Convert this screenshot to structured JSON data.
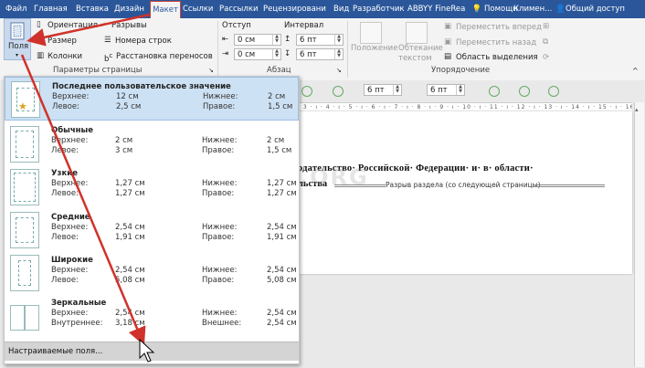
{
  "tabs": [
    "Файл",
    "Главная",
    "Вставка",
    "Дизайн",
    "Макет",
    "Ссылки",
    "Рассылки",
    "Рецензировани",
    "Вид",
    "Разработчик",
    "ABBYY FineRea"
  ],
  "active_tab": "Макет",
  "help": "Помощн",
  "user": "Климен...",
  "share": "Общий доступ",
  "ribbon": {
    "fields": "Поля",
    "orientation": "Ориентация",
    "size": "Размер",
    "columns": "Колонки",
    "breaks": "Разрывы",
    "line_numbers": "Номера строк",
    "hyphenation": "Расстановка переносов",
    "page_setup_group": "Параметры страницы",
    "indent_title": "Отступ",
    "indent_left": "0 см",
    "indent_right": "0 см",
    "interval_title": "Интервал",
    "spacing_before": "6 пт",
    "spacing_after": "6 пт",
    "paragraph_group": "Абзац",
    "position": "Положение",
    "wrap_text": "Обтекание текстом",
    "bring_forward": "Переместить вперед",
    "send_backward": "Переместить назад",
    "selection_pane": "Область выделения",
    "arrange_group": "Упорядочение"
  },
  "doc": {
    "spacing_value": "6 пт",
    "text_line1": "одательство· Российской· Федерации· и· в· области·",
    "text_line2": "льства",
    "section_break": "Разрыв раздела (со следующей страницы)",
    "watermark": "KAK-SDELAT.ORG"
  },
  "margins_menu": {
    "items": [
      {
        "title": "Последнее пользовательское значение",
        "top_label": "Верхнее:",
        "top": "12 см",
        "bottom_label": "Нижнее:",
        "bottom": "2 см",
        "left_label": "Левое:",
        "left": "2,5 см",
        "right_label": "Правое:",
        "right": "1,5 см"
      },
      {
        "title": "Обычные",
        "top_label": "Верхнее:",
        "top": "2 см",
        "bottom_label": "Нижнее:",
        "bottom": "2 см",
        "left_label": "Левое:",
        "left": "3 см",
        "right_label": "Правое:",
        "right": "1,5 см"
      },
      {
        "title": "Узкие",
        "top_label": "Верхнее:",
        "top": "1,27 см",
        "bottom_label": "Нижнее:",
        "bottom": "1,27 см",
        "left_label": "Левое:",
        "left": "1,27 см",
        "right_label": "Правое:",
        "right": "1,27 см"
      },
      {
        "title": "Средние",
        "top_label": "Верхнее:",
        "top": "2,54 см",
        "bottom_label": "Нижнее:",
        "bottom": "2,54 см",
        "left_label": "Левое:",
        "left": "1,91 см",
        "right_label": "Правое:",
        "right": "1,91 см"
      },
      {
        "title": "Широкие",
        "top_label": "Верхнее:",
        "top": "2,54 см",
        "bottom_label": "Нижнее:",
        "bottom": "2,54 см",
        "left_label": "Левое:",
        "left": "5,08 см",
        "right_label": "Правое:",
        "right": "5,08 см"
      },
      {
        "title": "Зеркальные",
        "top_label": "Верхнее:",
        "top": "2,54 см",
        "bottom_label": "Нижнее:",
        "bottom": "2,54 см",
        "left_label": "Внутреннее:",
        "left": "3,18 см",
        "right_label": "Внешнее:",
        "right": "2,54 см"
      }
    ],
    "custom": "Настраиваемые поля..."
  },
  "colors": {
    "tab_bar": "#2b579a",
    "arrow": "#d0322b"
  }
}
